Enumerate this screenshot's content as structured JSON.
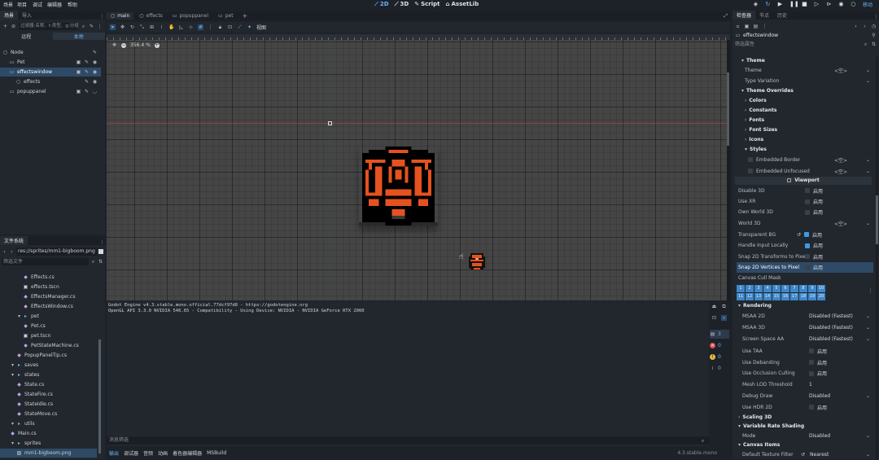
{
  "menubar": {
    "items": [
      "场景",
      "项目",
      "调试",
      "编辑器",
      "帮助"
    ],
    "modes": [
      {
        "label": "2D",
        "active": true
      },
      {
        "label": "3D",
        "active": false
      },
      {
        "label": "Script",
        "active": false
      },
      {
        "label": "AssetLib",
        "active": false
      }
    ],
    "renderer_label": "移动"
  },
  "scene_dock": {
    "tabs": [
      "场景",
      "导入"
    ],
    "filter_placeholder": "过滤器:名称、t:类型、g:分组",
    "remote": "远程",
    "local": "本地",
    "nodes": [
      {
        "label": "Node",
        "depth": 0
      },
      {
        "label": "Pet",
        "depth": 1
      },
      {
        "label": "effectswindow",
        "depth": 1,
        "selected": true
      },
      {
        "label": "effects",
        "depth": 2
      },
      {
        "label": "popuppanel",
        "depth": 1
      }
    ]
  },
  "filesystem": {
    "title": "文件系统",
    "path": "res://sprites/mm1-bigboom.png",
    "filter_placeholder": "筛选文件",
    "items": [
      {
        "label": "Effects.cs",
        "type": "cs",
        "depth": 3
      },
      {
        "label": "effects.tscn",
        "type": "tscn",
        "depth": 3
      },
      {
        "label": "EffectsManager.cs",
        "type": "cs",
        "depth": 3
      },
      {
        "label": "EffectsWindow.cs",
        "type": "cs",
        "depth": 3
      },
      {
        "label": "pet",
        "type": "folder",
        "depth": 2
      },
      {
        "label": "Pet.cs",
        "type": "cs",
        "depth": 3
      },
      {
        "label": "pet.tscn",
        "type": "tscn",
        "depth": 3
      },
      {
        "label": "PetStateMachine.cs",
        "type": "cs",
        "depth": 3
      },
      {
        "label": "PopupPanelTip.cs",
        "type": "cs",
        "depth": 2
      },
      {
        "label": "saves",
        "type": "folder",
        "depth": 1
      },
      {
        "label": "states",
        "type": "folder",
        "depth": 1
      },
      {
        "label": "State.cs",
        "type": "cs",
        "depth": 2
      },
      {
        "label": "StateFire.cs",
        "type": "cs",
        "depth": 2
      },
      {
        "label": "StateIdle.cs",
        "type": "cs",
        "depth": 2
      },
      {
        "label": "StateMove.cs",
        "type": "cs",
        "depth": 2
      },
      {
        "label": "utils",
        "type": "folder",
        "depth": 1
      },
      {
        "label": "Main.cs",
        "type": "cs",
        "depth": 1
      },
      {
        "label": "sprites",
        "type": "folder",
        "depth": 1
      },
      {
        "label": "mm1-bigboom.png",
        "type": "png",
        "depth": 2,
        "selected": true
      }
    ]
  },
  "editor_tabs": [
    {
      "label": "main",
      "active": true
    },
    {
      "label": "effects"
    },
    {
      "label": "popuppanel"
    },
    {
      "label": "pet"
    }
  ],
  "toolbar": {
    "view_label": "视图",
    "zoom": "356.4 %"
  },
  "output": {
    "lines": [
      "Godot Engine v4.3.stable.mono.official.77dcf97d8 - https://godotengine.org",
      "OpenGL API 3.3.0 NVIDIA 546.65 - Compatibility - Using Device: NVIDIA - NVIDIA GeForce RTX 2060"
    ],
    "filter_placeholder": "消息筛选",
    "counts": {
      "messages": "3",
      "errors": "0",
      "warnings": "0",
      "editor": "0"
    }
  },
  "bottom_tabs": [
    "输出",
    "调试器",
    "音频",
    "动画",
    "着色器编辑器",
    "MSBuild"
  ],
  "version": "4.3.stable.mono",
  "inspector": {
    "tabs": [
      "检查器",
      "节点",
      "历史"
    ],
    "object": "effectswindow",
    "filter_placeholder": "筛选属性",
    "on_label": "启用",
    "rows": [
      {
        "kind": "sect",
        "label": "Theme",
        "indent": 1
      },
      {
        "kind": "prop",
        "label": "Theme",
        "value": "<空>",
        "indent": 2
      },
      {
        "kind": "prop",
        "label": "Type Variation",
        "value": "",
        "indent": 2
      },
      {
        "kind": "sect",
        "label": "Theme Overrides",
        "indent": 1
      },
      {
        "kind": "sect",
        "label": "Colors",
        "indent": 2
      },
      {
        "kind": "sect",
        "label": "Constants",
        "indent": 2
      },
      {
        "kind": "sect",
        "label": "Fonts",
        "indent": 2
      },
      {
        "kind": "sect",
        "label": "Font Sizes",
        "indent": 2
      },
      {
        "kind": "sect",
        "label": "Icons",
        "indent": 2
      },
      {
        "kind": "sect",
        "label": "Styles",
        "indent": 2
      },
      {
        "kind": "propchk",
        "label": "Embedded Border",
        "value": "<空>",
        "indent": 3
      },
      {
        "kind": "propchk",
        "label": "Embedded Unfocused",
        "value": "<空>",
        "indent": 3
      },
      {
        "kind": "header",
        "label": "Viewport"
      },
      {
        "kind": "bool",
        "label": "Disable 3D",
        "on": false
      },
      {
        "kind": "bool",
        "label": "Use XR",
        "on": false
      },
      {
        "kind": "bool",
        "label": "Own World 3D",
        "on": false
      },
      {
        "kind": "prop",
        "label": "World 3D",
        "value": "<空>",
        "indent": 0
      },
      {
        "kind": "bool",
        "label": "Transparent BG",
        "on": true,
        "reset": true
      },
      {
        "kind": "bool",
        "label": "Handle Input Locally",
        "on": true
      },
      {
        "kind": "bool",
        "label": "Snap 2D Transforms to Pixel",
        "on": false
      },
      {
        "kind": "bool",
        "label": "Snap 2D Vertices to Pixel",
        "on": false,
        "hl": true
      },
      {
        "kind": "label",
        "label": "Canvas Cull Mask"
      }
    ],
    "cull_mask": [
      "1",
      "2",
      "3",
      "4",
      "5",
      "6",
      "7",
      "8",
      "9",
      "10",
      "11",
      "12",
      "13",
      "14",
      "15",
      "16",
      "17",
      "18",
      "19",
      "20"
    ],
    "rendering": [
      {
        "kind": "sect",
        "label": "Rendering"
      },
      {
        "kind": "prop",
        "label": "MSAA 2D",
        "value": "Disabled (Fastest)"
      },
      {
        "kind": "prop",
        "label": "MSAA 3D",
        "value": "Disabled (Fastest)"
      },
      {
        "kind": "prop",
        "label": "Screen Space AA",
        "value": "Disabled (Fastest)"
      },
      {
        "kind": "bool",
        "label": "Use TAA",
        "on": false
      },
      {
        "kind": "bool",
        "label": "Use Debanding",
        "on": false
      },
      {
        "kind": "bool",
        "label": "Use Occlusion Culling",
        "on": false
      },
      {
        "kind": "prop",
        "label": "Mesh LOD Threshold",
        "value": "1"
      },
      {
        "kind": "prop",
        "label": "Debug Draw",
        "value": "Disabled"
      },
      {
        "kind": "bool",
        "label": "Use HDR 2D",
        "on": false
      },
      {
        "kind": "sect",
        "label": "Scaling 3D"
      },
      {
        "kind": "sect",
        "label": "Variable Rate Shading"
      },
      {
        "kind": "prop",
        "label": "Mode",
        "value": "Disabled"
      },
      {
        "kind": "sect",
        "label": "Canvas Items"
      },
      {
        "kind": "prop",
        "label": "Default Texture Filter",
        "value": "Nearest",
        "reset": true
      }
    ]
  },
  "colors": {
    "accent": "#68b5ff",
    "selected": "#2e4a66",
    "orange": "#e5521f",
    "check_on": "#3c9be6"
  }
}
